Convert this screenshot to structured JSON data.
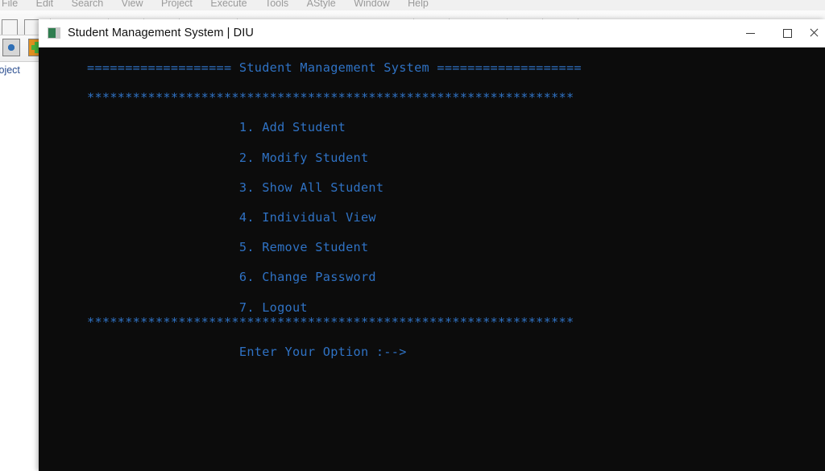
{
  "ide": {
    "name": "dev-cpp-ide",
    "menubar": [
      {
        "label": "File"
      },
      {
        "label": "Edit"
      },
      {
        "label": "Search"
      },
      {
        "label": "View"
      },
      {
        "label": "Project"
      },
      {
        "label": "Execute"
      },
      {
        "label": "Tools"
      },
      {
        "label": "AStyle"
      },
      {
        "label": "Window"
      },
      {
        "label": "Help"
      }
    ],
    "panel_tab_label": "Project"
  },
  "console": {
    "title": "Student Management System | DIU",
    "app_icon": "console-app-icon",
    "background_color": "#0c0c0c",
    "text_color": "#2f72c4",
    "window_controls": {
      "minimize_label": "Minimize",
      "maximize_label": "Maximize",
      "close_label": "Close"
    },
    "lines": [
      "=================== Student Management System ===================",
      "",
      "****************************************************************",
      "",
      "                    1. Add Student",
      "",
      "                    2. Modify Student",
      "",
      "                    3. Show All Student",
      "",
      "                    4. Individual View",
      "",
      "                    5. Remove Student",
      "",
      "                    6. Change Password",
      "",
      "                    7. Logout",
      "****************************************************************",
      "",
      "                    Enter Your Option :-->"
    ],
    "menu_options": [
      {
        "number": "1.",
        "label": "Add Student"
      },
      {
        "number": "2.",
        "label": "Modify Student"
      },
      {
        "number": "3.",
        "label": "Show All Student"
      },
      {
        "number": "4.",
        "label": "Individual View"
      },
      {
        "number": "5.",
        "label": "Remove Student"
      },
      {
        "number": "6.",
        "label": "Change Password"
      },
      {
        "number": "7.",
        "label": "Logout"
      }
    ],
    "header_text": "Student Management System",
    "prompt_text": "Enter Your Option :-->"
  }
}
